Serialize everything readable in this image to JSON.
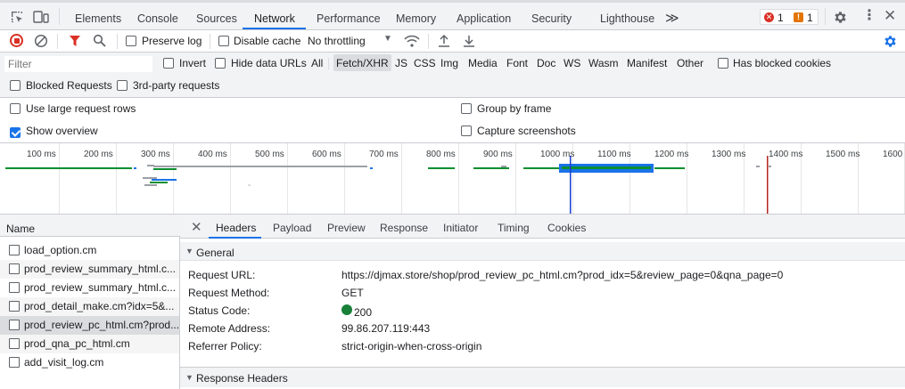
{
  "top_tabs": [
    "Elements",
    "Console",
    "Sources",
    "Network",
    "Performance",
    "Memory",
    "Application",
    "Security",
    "Lighthouse"
  ],
  "active_top_tab": "Network",
  "more_tabs_glyph": "≫",
  "error_count": "1",
  "warning_count": "1",
  "toolbar": {
    "preserve_log": "Preserve log",
    "disable_cache": "Disable cache",
    "throttling": "No throttling"
  },
  "filter_bar": {
    "placeholder": "Filter",
    "invert": "Invert",
    "hide_data_urls": "Hide data URLs",
    "types": [
      "All",
      "Fetch/XHR",
      "JS",
      "CSS",
      "Img",
      "Media",
      "Font",
      "Doc",
      "WS",
      "Wasm",
      "Manifest",
      "Other"
    ],
    "active_type": "Fetch/XHR",
    "has_blocked_cookies": "Has blocked cookies",
    "blocked_requests": "Blocked Requests",
    "third_party": "3rd-party requests"
  },
  "settings": {
    "large_rows": "Use large request rows",
    "group_by_frame": "Group by frame",
    "show_overview": "Show overview",
    "capture_screenshots": "Capture screenshots"
  },
  "timeline_ticks": [
    "100 ms",
    "200 ms",
    "300 ms",
    "400 ms",
    "500 ms",
    "600 ms",
    "700 ms",
    "800 ms",
    "900 ms",
    "1000 ms",
    "1100 ms",
    "1200 ms",
    "1300 ms",
    "1400 ms",
    "1500 ms",
    "1600"
  ],
  "request_list": {
    "header": "Name",
    "items": [
      "load_option.cm",
      "prod_review_summary_html.c...",
      "prod_review_summary_html.c...",
      "prod_detail_make.cm?idx=5&...",
      "prod_review_pc_html.cm?prod...",
      "prod_qna_pc_html.cm",
      "add_visit_log.cm"
    ],
    "selected_index": 4
  },
  "detail_tabs": [
    "Headers",
    "Payload",
    "Preview",
    "Response",
    "Initiator",
    "Timing",
    "Cookies"
  ],
  "active_detail_tab": "Headers",
  "general": {
    "section_title": "General",
    "rows": [
      {
        "key": "Request URL:",
        "value": "https://djmax.store/shop/prod_review_pc_html.cm?prod_idx=5&review_page=0&qna_page=0"
      },
      {
        "key": "Request Method:",
        "value": "GET"
      },
      {
        "key": "Status Code:",
        "value": "200"
      },
      {
        "key": "Remote Address:",
        "value": "99.86.207.119:443"
      },
      {
        "key": "Referrer Policy:",
        "value": "strict-origin-when-cross-origin"
      }
    ]
  },
  "response_headers_title": "Response Headers",
  "colors": {
    "accent": "#1a73e8",
    "status_ok": "#188038",
    "error": "#d93025",
    "warning": "#e37400"
  }
}
